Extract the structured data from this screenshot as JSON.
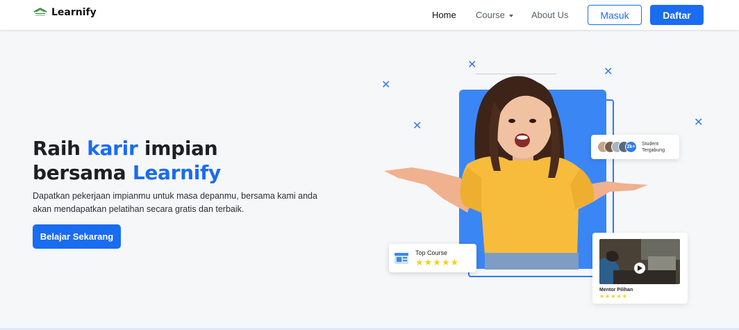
{
  "navbar": {
    "brand": "Learnify",
    "links": [
      "Home",
      "Course",
      "About Us"
    ],
    "login_label": "Masuk",
    "register_label": "Daftar"
  },
  "hero": {
    "title_part1": "Raih ",
    "title_highlight1": "karir",
    "title_part2": " impian",
    "title_part3": "bersama ",
    "title_highlight2": "Learnify",
    "description": "Dapatkan pekerjaan impianmu untuk masa depanmu, bersama kami anda akan mendapatkan pelatihan secara gratis dan terbaik.",
    "cta_label": "Belajar Sekarang"
  },
  "cards": {
    "student": {
      "count": "2k+",
      "label": "Student Tergabung"
    },
    "top_course": {
      "label": "Top Course",
      "rating": 5,
      "stars": "★★★★★"
    },
    "mentor": {
      "label": "Mentor Pilihan",
      "rating": 5,
      "stars": "★★★★★"
    }
  },
  "colors": {
    "primary": "#1a6cf0",
    "panel": "#3b86f5",
    "star": "#f2d11a"
  },
  "icons": [
    "logo-icon",
    "caret-down-icon",
    "cross-decor-icon",
    "course-icon",
    "play-icon"
  ]
}
